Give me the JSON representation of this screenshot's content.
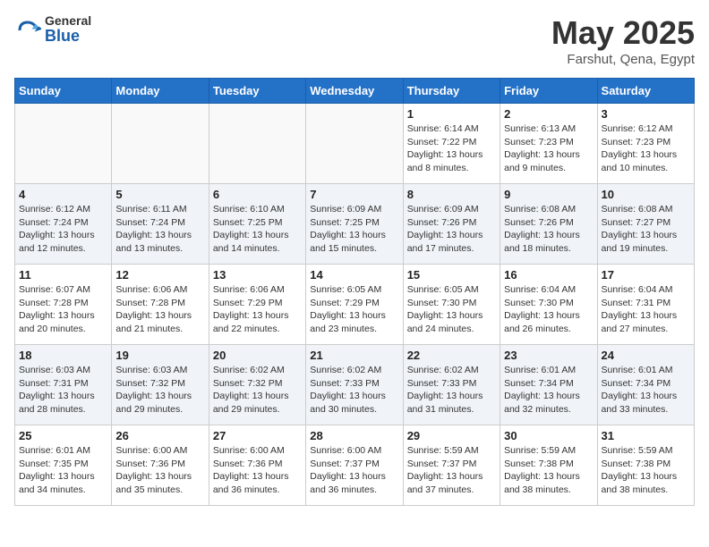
{
  "header": {
    "logo_general": "General",
    "logo_blue": "Blue",
    "month_year": "May 2025",
    "location": "Farshut, Qena, Egypt"
  },
  "weekdays": [
    "Sunday",
    "Monday",
    "Tuesday",
    "Wednesday",
    "Thursday",
    "Friday",
    "Saturday"
  ],
  "weeks": [
    [
      {
        "day": "",
        "text": ""
      },
      {
        "day": "",
        "text": ""
      },
      {
        "day": "",
        "text": ""
      },
      {
        "day": "",
        "text": ""
      },
      {
        "day": "1",
        "text": "Sunrise: 6:14 AM\nSunset: 7:22 PM\nDaylight: 13 hours\nand 8 minutes."
      },
      {
        "day": "2",
        "text": "Sunrise: 6:13 AM\nSunset: 7:23 PM\nDaylight: 13 hours\nand 9 minutes."
      },
      {
        "day": "3",
        "text": "Sunrise: 6:12 AM\nSunset: 7:23 PM\nDaylight: 13 hours\nand 10 minutes."
      }
    ],
    [
      {
        "day": "4",
        "text": "Sunrise: 6:12 AM\nSunset: 7:24 PM\nDaylight: 13 hours\nand 12 minutes."
      },
      {
        "day": "5",
        "text": "Sunrise: 6:11 AM\nSunset: 7:24 PM\nDaylight: 13 hours\nand 13 minutes."
      },
      {
        "day": "6",
        "text": "Sunrise: 6:10 AM\nSunset: 7:25 PM\nDaylight: 13 hours\nand 14 minutes."
      },
      {
        "day": "7",
        "text": "Sunrise: 6:09 AM\nSunset: 7:25 PM\nDaylight: 13 hours\nand 15 minutes."
      },
      {
        "day": "8",
        "text": "Sunrise: 6:09 AM\nSunset: 7:26 PM\nDaylight: 13 hours\nand 17 minutes."
      },
      {
        "day": "9",
        "text": "Sunrise: 6:08 AM\nSunset: 7:26 PM\nDaylight: 13 hours\nand 18 minutes."
      },
      {
        "day": "10",
        "text": "Sunrise: 6:08 AM\nSunset: 7:27 PM\nDaylight: 13 hours\nand 19 minutes."
      }
    ],
    [
      {
        "day": "11",
        "text": "Sunrise: 6:07 AM\nSunset: 7:28 PM\nDaylight: 13 hours\nand 20 minutes."
      },
      {
        "day": "12",
        "text": "Sunrise: 6:06 AM\nSunset: 7:28 PM\nDaylight: 13 hours\nand 21 minutes."
      },
      {
        "day": "13",
        "text": "Sunrise: 6:06 AM\nSunset: 7:29 PM\nDaylight: 13 hours\nand 22 minutes."
      },
      {
        "day": "14",
        "text": "Sunrise: 6:05 AM\nSunset: 7:29 PM\nDaylight: 13 hours\nand 23 minutes."
      },
      {
        "day": "15",
        "text": "Sunrise: 6:05 AM\nSunset: 7:30 PM\nDaylight: 13 hours\nand 24 minutes."
      },
      {
        "day": "16",
        "text": "Sunrise: 6:04 AM\nSunset: 7:30 PM\nDaylight: 13 hours\nand 26 minutes."
      },
      {
        "day": "17",
        "text": "Sunrise: 6:04 AM\nSunset: 7:31 PM\nDaylight: 13 hours\nand 27 minutes."
      }
    ],
    [
      {
        "day": "18",
        "text": "Sunrise: 6:03 AM\nSunset: 7:31 PM\nDaylight: 13 hours\nand 28 minutes."
      },
      {
        "day": "19",
        "text": "Sunrise: 6:03 AM\nSunset: 7:32 PM\nDaylight: 13 hours\nand 29 minutes."
      },
      {
        "day": "20",
        "text": "Sunrise: 6:02 AM\nSunset: 7:32 PM\nDaylight: 13 hours\nand 29 minutes."
      },
      {
        "day": "21",
        "text": "Sunrise: 6:02 AM\nSunset: 7:33 PM\nDaylight: 13 hours\nand 30 minutes."
      },
      {
        "day": "22",
        "text": "Sunrise: 6:02 AM\nSunset: 7:33 PM\nDaylight: 13 hours\nand 31 minutes."
      },
      {
        "day": "23",
        "text": "Sunrise: 6:01 AM\nSunset: 7:34 PM\nDaylight: 13 hours\nand 32 minutes."
      },
      {
        "day": "24",
        "text": "Sunrise: 6:01 AM\nSunset: 7:34 PM\nDaylight: 13 hours\nand 33 minutes."
      }
    ],
    [
      {
        "day": "25",
        "text": "Sunrise: 6:01 AM\nSunset: 7:35 PM\nDaylight: 13 hours\nand 34 minutes."
      },
      {
        "day": "26",
        "text": "Sunrise: 6:00 AM\nSunset: 7:36 PM\nDaylight: 13 hours\nand 35 minutes."
      },
      {
        "day": "27",
        "text": "Sunrise: 6:00 AM\nSunset: 7:36 PM\nDaylight: 13 hours\nand 36 minutes."
      },
      {
        "day": "28",
        "text": "Sunrise: 6:00 AM\nSunset: 7:37 PM\nDaylight: 13 hours\nand 36 minutes."
      },
      {
        "day": "29",
        "text": "Sunrise: 5:59 AM\nSunset: 7:37 PM\nDaylight: 13 hours\nand 37 minutes."
      },
      {
        "day": "30",
        "text": "Sunrise: 5:59 AM\nSunset: 7:38 PM\nDaylight: 13 hours\nand 38 minutes."
      },
      {
        "day": "31",
        "text": "Sunrise: 5:59 AM\nSunset: 7:38 PM\nDaylight: 13 hours\nand 38 minutes."
      }
    ]
  ]
}
